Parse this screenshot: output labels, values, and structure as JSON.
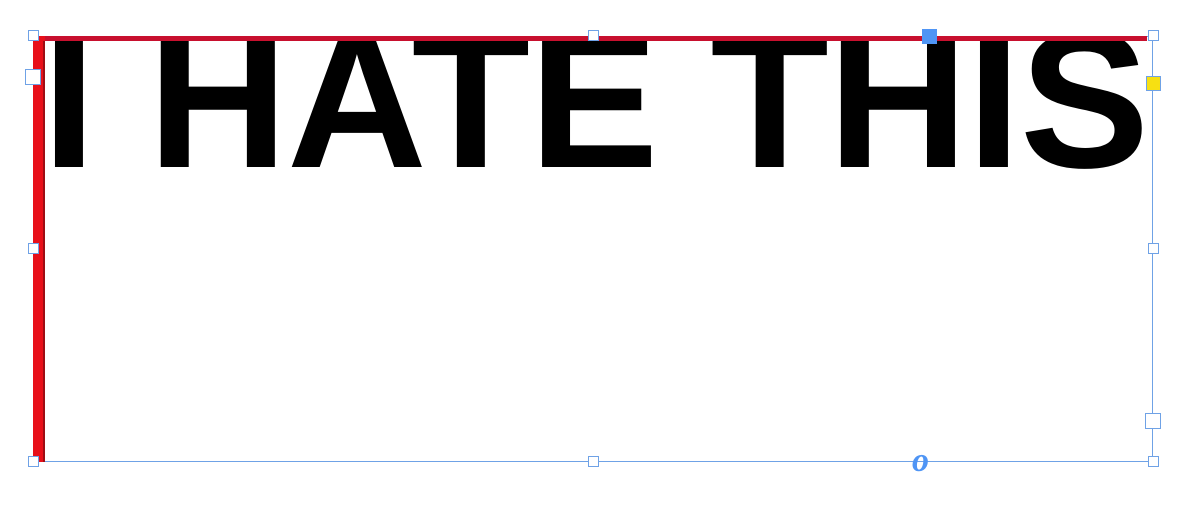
{
  "canvas": {
    "text_frame": {
      "text": "I HATE THIS",
      "baseline_marker_glyph": "o",
      "handles": [
        "top-left-handle",
        "top-center-handle",
        "top-right-handle",
        "middle-left-handle",
        "middle-right-handle",
        "bottom-left-handle",
        "bottom-center-handle",
        "bottom-right-handle"
      ]
    },
    "colors": {
      "text": "#000000",
      "frame_border": "#6fa2e6",
      "rule_red": "#c8102e",
      "accent_blue": "#4f95f5",
      "indicator_yellow": "#f7e012"
    }
  }
}
